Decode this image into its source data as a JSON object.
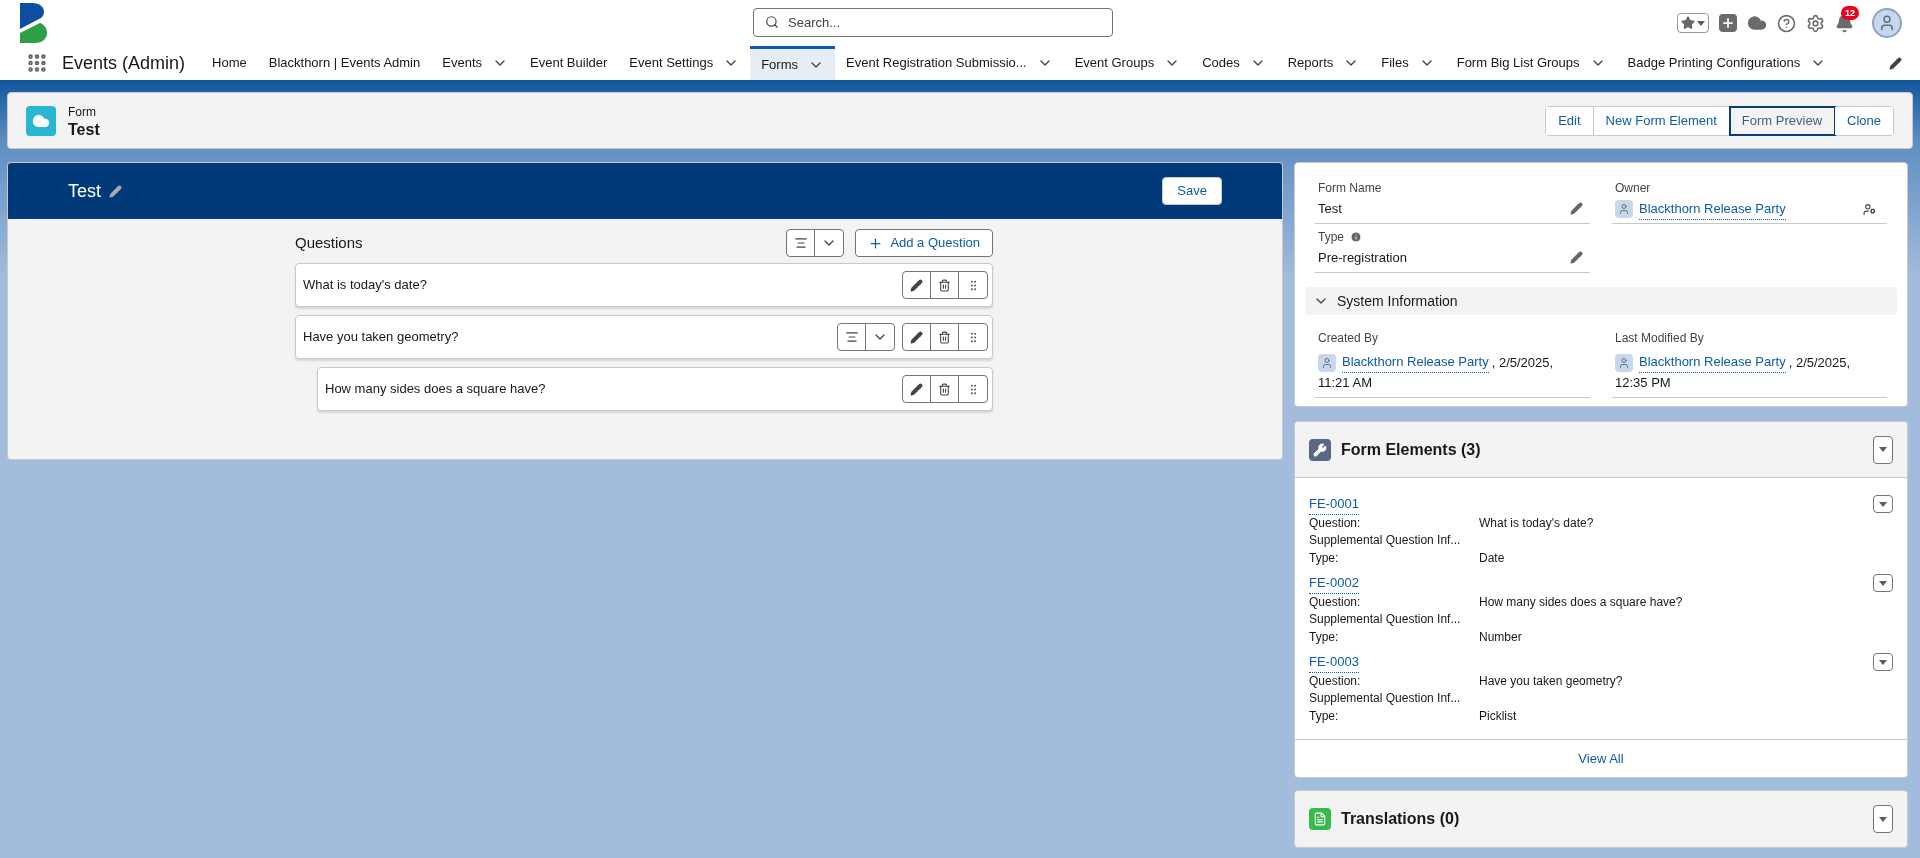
{
  "app": {
    "name": "Events (Admin)"
  },
  "search": {
    "placeholder": "Search..."
  },
  "notifications": {
    "count": "12"
  },
  "nav": [
    {
      "label": "Home",
      "menu": false,
      "selected": false
    },
    {
      "label": "Blackthorn | Events Admin",
      "menu": false,
      "selected": false
    },
    {
      "label": "Events",
      "menu": true,
      "selected": false
    },
    {
      "label": "Event Builder",
      "menu": false,
      "selected": false
    },
    {
      "label": "Event Settings",
      "menu": true,
      "selected": false
    },
    {
      "label": "Forms",
      "menu": true,
      "selected": true
    },
    {
      "label": "Event Registration Submissio...",
      "menu": true,
      "selected": false
    },
    {
      "label": "Event Groups",
      "menu": true,
      "selected": false
    },
    {
      "label": "Codes",
      "menu": true,
      "selected": false
    },
    {
      "label": "Reports",
      "menu": true,
      "selected": false
    },
    {
      "label": "Files",
      "menu": true,
      "selected": false
    },
    {
      "label": "Form Big List Groups",
      "menu": true,
      "selected": false
    },
    {
      "label": "Badge Printing Configurations",
      "menu": true,
      "selected": false
    }
  ],
  "record": {
    "object": "Form",
    "title": "Test",
    "actions": [
      {
        "label": "Edit",
        "selected": false
      },
      {
        "label": "New Form Element",
        "selected": false
      },
      {
        "label": "Form Preview",
        "selected": true
      },
      {
        "label": "Clone",
        "selected": false
      }
    ]
  },
  "builder": {
    "title": "Test",
    "save": "Save",
    "questions_heading": "Questions",
    "add_button": "Add a Question",
    "questions": [
      {
        "text": "What is today's date?",
        "branching": false
      },
      {
        "text": "Have you taken geometry?",
        "branching": true,
        "children": [
          {
            "text": "How many sides does a square have?",
            "branching": false
          }
        ]
      }
    ]
  },
  "details": {
    "fields": [
      {
        "label": "Form Name",
        "value": "Test",
        "kind": "text",
        "info": false
      },
      {
        "label": "Owner",
        "value": "Blackthorn Release Party",
        "kind": "user",
        "info": false
      },
      {
        "label": "Type",
        "value": "Pre-registration",
        "kind": "text",
        "info": true
      }
    ],
    "section": {
      "title": "System Information",
      "expanded": true,
      "fields": [
        {
          "label": "Created By",
          "user": "Blackthorn Release Party",
          "date": ", 2/5/2025,",
          "time": "11:21 AM"
        },
        {
          "label": "Last Modified By",
          "user": "Blackthorn Release Party",
          "date": ", 2/5/2025,",
          "time": "12:35 PM"
        }
      ]
    }
  },
  "form_elements": {
    "title": "Form Elements (3)",
    "items": [
      {
        "id": "FE-0001",
        "rows": [
          {
            "label": "Question:",
            "value": "What is today's date?"
          },
          {
            "label": "Supplemental Question Inf..."
          },
          {
            "label": "Type:",
            "value": "Date"
          }
        ]
      },
      {
        "id": "FE-0002",
        "rows": [
          {
            "label": "Question:",
            "value": "How many sides does a square have?"
          },
          {
            "label": "Supplemental Question Inf..."
          },
          {
            "label": "Type:",
            "value": "Number"
          }
        ]
      },
      {
        "id": "FE-0003",
        "rows": [
          {
            "label": "Question:",
            "value": "Have you taken geometry?"
          },
          {
            "label": "Supplemental Question Inf..."
          },
          {
            "label": "Type:",
            "value": "Picklist"
          }
        ]
      }
    ],
    "view_all": "View All"
  },
  "translations": {
    "title": "Translations (0)"
  }
}
